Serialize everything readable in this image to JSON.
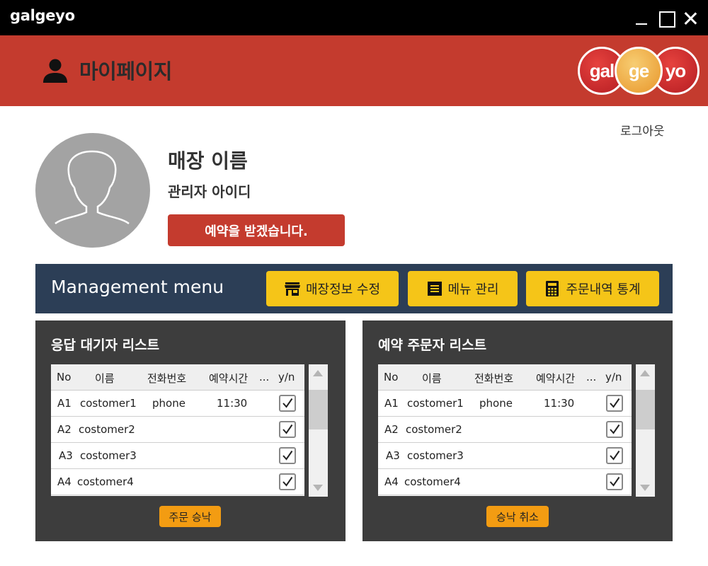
{
  "window": {
    "title": "galgeyo"
  },
  "header": {
    "page_title": "마이페이지",
    "logo": [
      "gal",
      "ge",
      "yo"
    ],
    "color": "#c43b2e"
  },
  "profile": {
    "logout": "로그아웃",
    "store_name": "매장 이름",
    "admin_id": "관리자 아이디",
    "reserve_button": "예약을 받겠습니다."
  },
  "management": {
    "title": "Management menu",
    "buttons": [
      {
        "label": "매장정보 수정",
        "icon": "store-icon"
      },
      {
        "label": "메뉴 관리",
        "icon": "list-icon"
      },
      {
        "label": "주문내역 통계",
        "icon": "calculator-icon"
      }
    ],
    "accent": "#f5c518",
    "bar_color": "#2c3e56"
  },
  "waiting_list": {
    "title": "응답 대기자 리스트",
    "columns": [
      "No",
      "이름",
      "전화번호",
      "예약시간",
      "...",
      "y/n"
    ],
    "rows": [
      {
        "no": "A1",
        "name": "costomer1",
        "phone": "phone",
        "time": "11:30",
        "checked": true
      },
      {
        "no": "A2",
        "name": "costomer2",
        "phone": "",
        "time": "",
        "checked": true
      },
      {
        "no": "A3",
        "name": "costomer3",
        "phone": "",
        "time": "",
        "checked": true
      },
      {
        "no": "A4",
        "name": "costomer4",
        "phone": "",
        "time": "",
        "checked": true
      }
    ],
    "action": "주문 승낙"
  },
  "reservation_list": {
    "title": "예약 주문자 리스트",
    "columns": [
      "No",
      "이름",
      "전화번호",
      "예약시간",
      "...",
      "y/n"
    ],
    "rows": [
      {
        "no": "A1",
        "name": "costomer1",
        "phone": "phone",
        "time": "11:30",
        "checked": true
      },
      {
        "no": "A2",
        "name": "costomer2",
        "phone": "",
        "time": "",
        "checked": true
      },
      {
        "no": "A3",
        "name": "costomer3",
        "phone": "",
        "time": "",
        "checked": true
      },
      {
        "no": "A4",
        "name": "costomer4",
        "phone": "",
        "time": "",
        "checked": true
      }
    ],
    "action": "승낙 취소"
  }
}
